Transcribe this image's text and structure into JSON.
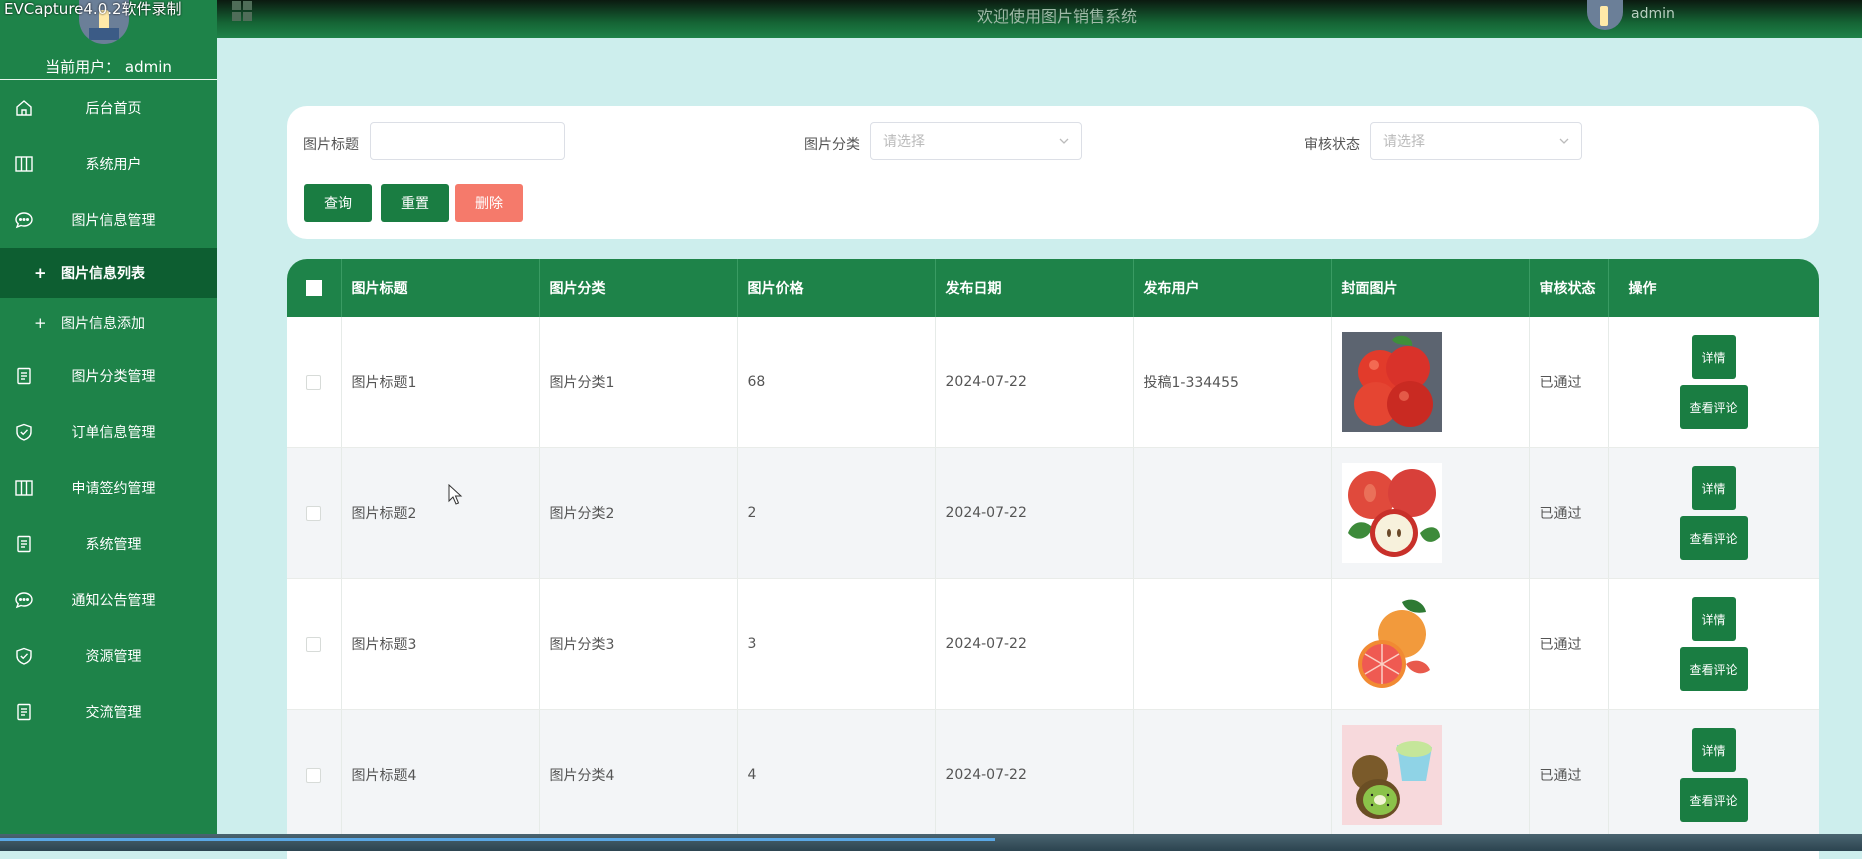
{
  "watermark": "EVCapture4.0.2软件录制",
  "sidebar": {
    "current_user_label": "当前用户：",
    "current_user": "admin",
    "menu": [
      {
        "label": "后台首页",
        "icon": "home-icon"
      },
      {
        "label": "系统用户",
        "icon": "columns-icon"
      },
      {
        "label": "图片信息管理",
        "icon": "chat-icon"
      }
    ],
    "submenu": [
      {
        "label": "图片信息列表",
        "active": true
      },
      {
        "label": "图片信息添加",
        "active": false
      }
    ],
    "menu2": [
      {
        "label": "图片分类管理",
        "icon": "document-icon"
      },
      {
        "label": "订单信息管理",
        "icon": "shield-check-icon"
      },
      {
        "label": "申请签约管理",
        "icon": "columns-icon"
      },
      {
        "label": "系统管理",
        "icon": "document-icon"
      },
      {
        "label": "通知公告管理",
        "icon": "chat-icon"
      },
      {
        "label": "资源管理",
        "icon": "shield-check-icon"
      },
      {
        "label": "交流管理",
        "icon": "document-icon"
      }
    ]
  },
  "topbar": {
    "title": "欢迎使用图片销售系统",
    "user": "admin"
  },
  "search": {
    "title_label": "图片标题",
    "title_value": "",
    "category_label": "图片分类",
    "category_placeholder": "请选择",
    "status_label": "审核状态",
    "status_placeholder": "请选择",
    "query_btn": "查询",
    "reset_btn": "重置",
    "delete_btn": "删除"
  },
  "table": {
    "headers": [
      "图片标题",
      "图片分类",
      "图片价格",
      "发布日期",
      "发布用户",
      "封面图片",
      "审核状态",
      "操作"
    ],
    "detail_btn": "详情",
    "comment_btn": "查看评论",
    "rows": [
      {
        "title": "图片标题1",
        "category": "图片分类1",
        "price": "68",
        "date": "2024-07-22",
        "user": "投稿1-334455",
        "status": "已通过"
      },
      {
        "title": "图片标题2",
        "category": "图片分类2",
        "price": "2",
        "date": "2024-07-22",
        "user": "",
        "status": "已通过"
      },
      {
        "title": "图片标题3",
        "category": "图片分类3",
        "price": "3",
        "date": "2024-07-22",
        "user": "",
        "status": "已通过"
      },
      {
        "title": "图片标题4",
        "category": "图片分类4",
        "price": "4",
        "date": "2024-07-22",
        "user": "",
        "status": "已通过"
      }
    ]
  }
}
